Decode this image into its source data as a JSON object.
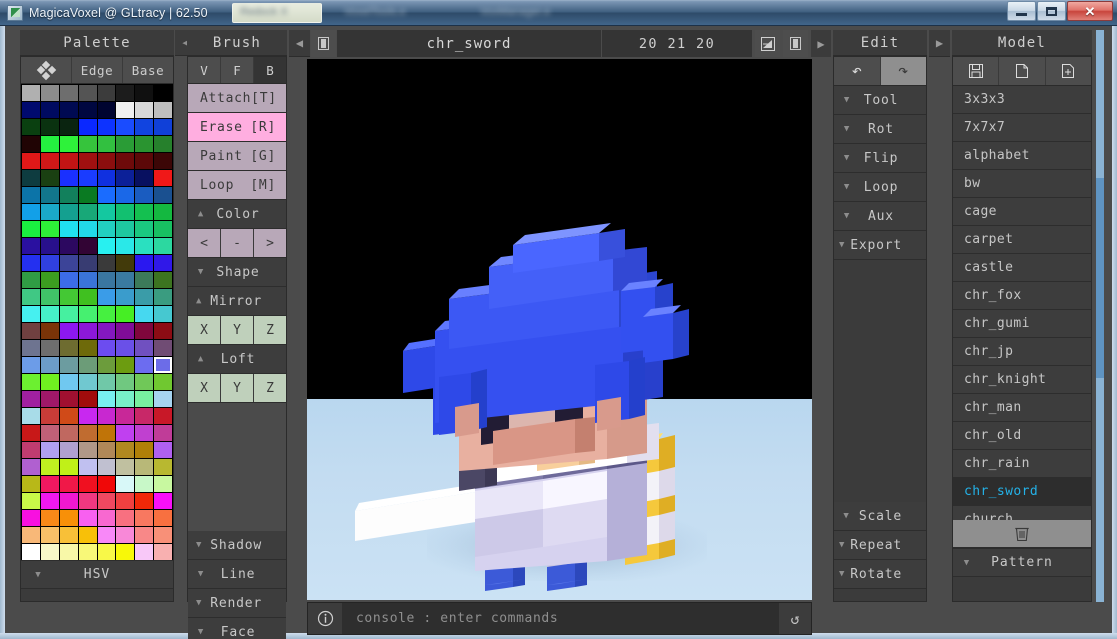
{
  "window": {
    "title": "MagicaVoxel @ GLtracy | 62.50",
    "icon": "app-icon",
    "blurred_tabs": [
      "Redock  X",
      "VoxelTools.e",
      "VoxManager.e"
    ],
    "controls": {
      "minimize": "—",
      "maximize": "□",
      "close": "✕"
    }
  },
  "palette": {
    "title": "Palette",
    "collapse": "◀",
    "tabs": [
      {
        "name": "grid-tab",
        "label": ""
      },
      {
        "name": "edge-tab",
        "label": "Edge"
      },
      {
        "name": "base-tab",
        "label": "Base"
      }
    ],
    "hsv_label": "HSV",
    "hsv_arrow": "▼",
    "selected_index": 135,
    "colors": [
      "#b0b0b0",
      "#8c8c8c",
      "#6e6e6e",
      "#545454",
      "#3c3c3c",
      "#1c1c1c",
      "#101010",
      "#000000",
      "#000a6e",
      "#000a60",
      "#000a52",
      "#000740",
      "#000430",
      "#f0f0f0",
      "#d8d8d8",
      "#bebebe",
      "#0a4010",
      "#0a3210",
      "#0a2410",
      "#0a28ff",
      "#0d33ff",
      "#1a4cff",
      "#1144e0",
      "#1040d8",
      "#200404",
      "#24f040",
      "#2ef23a",
      "#36c43c",
      "#32c040",
      "#2a9c36",
      "#2a9430",
      "#26802c",
      "#e01818",
      "#d01818",
      "#c21414",
      "#a01010",
      "#8c0e0e",
      "#6e0a0a",
      "#5c0808",
      "#3c0606",
      "#0e3c40",
      "#1a4012",
      "#1a30ff",
      "#1a3cff",
      "#1030e0",
      "#0c2098",
      "#081060",
      "#f01818",
      "#0c74a8",
      "#12768c",
      "#12805c",
      "#0a7a22",
      "#1a6cff",
      "#1a68e8",
      "#1a5cc0",
      "#1a5090",
      "#12a0e8",
      "#1aa8c8",
      "#14a090",
      "#18a878",
      "#14c8a0",
      "#12c070",
      "#14c050",
      "#14b840",
      "#1af040",
      "#2ef038",
      "#20e0f0",
      "#22d8e8",
      "#22d0c0",
      "#1ec8a0",
      "#1ac880",
      "#18c062",
      "#2a10a0",
      "#28108c",
      "#2c0860",
      "#320434",
      "#28f0f0",
      "#2ae8e8",
      "#2ae0c0",
      "#2cd8a0",
      "#2430f0",
      "#3040e0",
      "#3c4498",
      "#383c72",
      "#3a3a3a",
      "#423a0a",
      "#2a18f0",
      "#3018e8",
      "#309c44",
      "#3c9c20",
      "#3c6ce8",
      "#3a74d8",
      "#3a76a0",
      "#3a7aa0",
      "#3c7a5a",
      "#3c7420",
      "#40c884",
      "#40c468",
      "#44c834",
      "#40c020",
      "#3a9ce8",
      "#3a9ccc",
      "#3a9ca8",
      "#3a9c80",
      "#46f0f0",
      "#46f0c8",
      "#46f0a0",
      "#46f070",
      "#46f040",
      "#46ee24",
      "#46d8f0",
      "#46c8d0",
      "#704040",
      "#7a3408",
      "#8c18f0",
      "#8c18d8",
      "#8418c0",
      "#800c98",
      "#80063c",
      "#8c0c14",
      "#6e7490",
      "#6e6e6e",
      "#6e6c30",
      "#6e6a0a",
      "#6c4cf0",
      "#6a50e8",
      "#7050c0",
      "#704c74",
      "#6c9ce8",
      "#6c9cc8",
      "#6c9ca0",
      "#6c9c78",
      "#6c9c3c",
      "#6c9c10",
      "#6c6cf0",
      "#6c6ce8",
      "#6cf030",
      "#70f020",
      "#70c8f0",
      "#70c8d0",
      "#70c8a8",
      "#70c880",
      "#70c858",
      "#70c830",
      "#a020a0",
      "#a01868",
      "#a01030",
      "#a00c0c",
      "#78f0f0",
      "#78f0c8",
      "#78f0a0",
      "#a6d4f0",
      "#a8dce8",
      "#c83c38",
      "#d04a18",
      "#c828f0",
      "#c828d0",
      "#c82898",
      "#c82868",
      "#c81828",
      "#c81818",
      "#c06078",
      "#c06860",
      "#c06c30",
      "#c07408",
      "#c040f0",
      "#c040d0",
      "#c03c98",
      "#c03c70",
      "#b0a0f0",
      "#b0a0d0",
      "#b09888",
      "#b08858",
      "#b08820",
      "#b08008",
      "#b060f0",
      "#b060d0",
      "#c0f020",
      "#c0f018",
      "#c0c0f0",
      "#c0c0d0",
      "#c0c0a0",
      "#b8b878",
      "#b8b830",
      "#b8b818",
      "#f01860",
      "#f01848",
      "#f01020",
      "#f00808",
      "#d8f8f8",
      "#c8f8c8",
      "#c8f8a0",
      "#c8f848",
      "#f018f0",
      "#f018d0",
      "#f03880",
      "#f04860",
      "#f04040",
      "#f02808",
      "#f810f8",
      "#f810e0",
      "#f88818",
      "#f89008",
      "#f860f0",
      "#f868d0",
      "#f87080",
      "#f87860",
      "#f87040",
      "#f8b878",
      "#f8c068",
      "#f8c038",
      "#f8c008",
      "#f888f8",
      "#f888d8",
      "#f88888",
      "#f89078",
      "#ffffff",
      "#f8f8c8",
      "#f8f8a8",
      "#f8f878",
      "#f8f848",
      "#f8f808",
      "#f8c8f8",
      "#f8b0b0"
    ]
  },
  "brush": {
    "title": "Brush",
    "collapse": "◀",
    "axis_buttons": [
      {
        "label": "V",
        "active": false
      },
      {
        "label": "F",
        "active": false
      },
      {
        "label": "B",
        "active": true
      }
    ],
    "modes": [
      {
        "label": "Attach",
        "key": "[T]",
        "active": false
      },
      {
        "label": "Erase",
        "key": "[R]",
        "active": true
      },
      {
        "label": "Paint",
        "key": "[G]",
        "active": false
      },
      {
        "label": "Loop",
        "key": "[M]",
        "active": false
      }
    ],
    "color_section": {
      "label": "Color",
      "arrow": "▲",
      "buttons": [
        "<",
        "-",
        ">"
      ]
    },
    "shape_section": {
      "label": "Shape",
      "arrow": "▼"
    },
    "mirror_section": {
      "label": "Mirror",
      "arrow": "▲",
      "axes": [
        "X",
        "Y",
        "Z"
      ]
    },
    "loft_section": {
      "label": "Loft",
      "arrow": "▲",
      "axes": [
        "X",
        "Y",
        "Z"
      ]
    },
    "bottom_sections": [
      {
        "label": "Shadow",
        "arrow": "▼"
      },
      {
        "label": "Line",
        "arrow": "▼"
      },
      {
        "label": "Render",
        "arrow": "▼"
      },
      {
        "label": "Face",
        "arrow": "▼"
      }
    ]
  },
  "viewport": {
    "toggle_icon": "panel-toggle-icon",
    "model_name": "chr_sword",
    "dimensions": "20 21 20",
    "btn_frame_icon": "frame-icon",
    "btn_panel_icon": "panel-icon",
    "next_arrow": "▶",
    "console": {
      "info_icon": "info-icon",
      "placeholder": "console : enter commands",
      "reset_icon": "↺"
    }
  },
  "edit": {
    "title": "Edit",
    "collapse": "▶",
    "undo": "↶",
    "redo": "↷",
    "sections": [
      {
        "label": "Tool",
        "arrow": "▼"
      },
      {
        "label": "Rot",
        "arrow": "▼"
      },
      {
        "label": "Flip",
        "arrow": "▼"
      },
      {
        "label": "Loop",
        "arrow": "▼"
      },
      {
        "label": "Aux",
        "arrow": "▼"
      },
      {
        "label": "Export",
        "arrow": "▼"
      }
    ],
    "bottom_sections": [
      {
        "label": "Scale",
        "arrow": "▼"
      },
      {
        "label": "Repeat",
        "arrow": "▼"
      },
      {
        "label": "Rotate",
        "arrow": "▼"
      }
    ]
  },
  "model": {
    "title": "Model",
    "tools": [
      {
        "name": "save-icon",
        "glyph": "save"
      },
      {
        "name": "new-file-icon",
        "glyph": "file"
      },
      {
        "name": "add-file-icon",
        "glyph": "file-plus"
      }
    ],
    "items": [
      {
        "label": "3x3x3",
        "selected": false
      },
      {
        "label": "7x7x7",
        "selected": false
      },
      {
        "label": "alphabet",
        "selected": false
      },
      {
        "label": "bw",
        "selected": false
      },
      {
        "label": "cage",
        "selected": false
      },
      {
        "label": "carpet",
        "selected": false
      },
      {
        "label": "castle",
        "selected": false
      },
      {
        "label": "chr_fox",
        "selected": false
      },
      {
        "label": "chr_gumi",
        "selected": false
      },
      {
        "label": "chr_jp",
        "selected": false
      },
      {
        "label": "chr_knight",
        "selected": false
      },
      {
        "label": "chr_man",
        "selected": false
      },
      {
        "label": "chr_old",
        "selected": false
      },
      {
        "label": "chr_rain",
        "selected": false
      },
      {
        "label": "chr_sword",
        "selected": true
      },
      {
        "label": "church",
        "selected": false
      }
    ],
    "delete_icon": "trash-icon",
    "pattern": {
      "label": "Pattern",
      "arrow": "▼"
    }
  },
  "accents": {
    "selected_model": "#24b2e8",
    "active_mode": "#ffaee0",
    "mode_button": "#b8a8b8",
    "axis_button": "#bfd0bb",
    "panel_bg": "#3b3b3b",
    "ground": "#c3dcf1"
  }
}
